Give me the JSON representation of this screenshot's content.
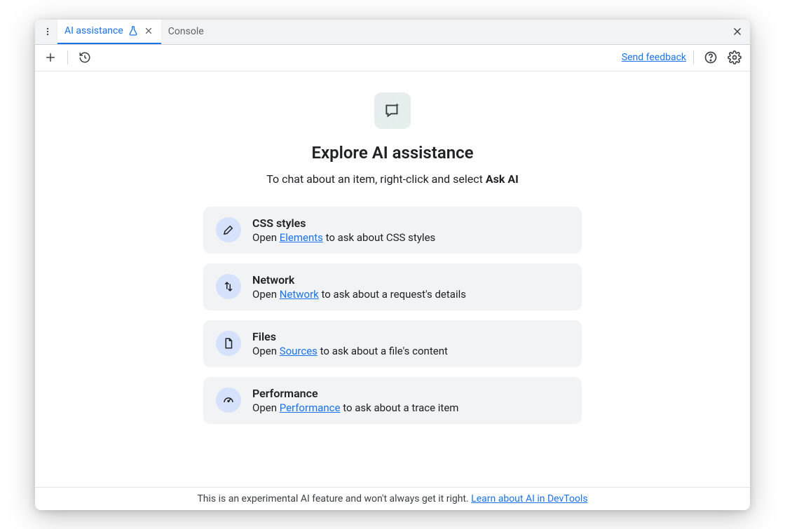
{
  "tabs": {
    "active_label": "AI assistance",
    "inactive_label": "Console"
  },
  "toolbar": {
    "feedback_label": "Send feedback"
  },
  "hero": {
    "headline": "Explore AI assistance",
    "subhead_prefix": "To chat about an item, right-click and select ",
    "subhead_bold": "Ask AI"
  },
  "cards": [
    {
      "title": "CSS styles",
      "desc_prefix": "Open ",
      "link_text": "Elements",
      "desc_suffix": " to ask about CSS styles"
    },
    {
      "title": "Network",
      "desc_prefix": "Open ",
      "link_text": "Network",
      "desc_suffix": " to ask about a request's details"
    },
    {
      "title": "Files",
      "desc_prefix": "Open ",
      "link_text": "Sources",
      "desc_suffix": " to ask about a file's content"
    },
    {
      "title": "Performance",
      "desc_prefix": "Open ",
      "link_text": "Performance",
      "desc_suffix": " to ask about a trace item"
    }
  ],
  "footer": {
    "text": "This is an experimental AI feature and won't always get it right. ",
    "link_text": "Learn about AI in DevTools"
  }
}
